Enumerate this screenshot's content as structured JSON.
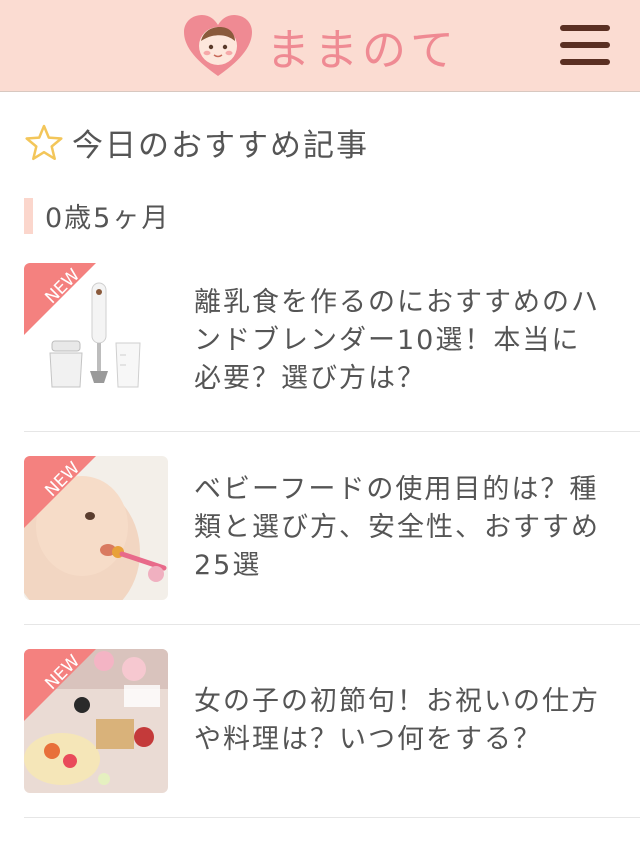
{
  "header": {
    "logo_text": "ままのて",
    "logo_icon": "baby-heart-icon",
    "menu_icon": "hamburger-menu-icon"
  },
  "section": {
    "title": "今日のおすすめ記事",
    "star_icon": "star-outline-icon",
    "age_label": "0歳5ヶ月"
  },
  "articles": [
    {
      "badge": "NEW",
      "title": "離乳食を作るのにおすすめのハンドブレンダー10選！本当に必要？選び方は？",
      "image": "hand-blender"
    },
    {
      "badge": "NEW",
      "title": "ベビーフードの使用目的は？種類と選び方、安全性、おすすめ25選",
      "image": "baby-eating"
    },
    {
      "badge": "NEW",
      "title": "女の子の初節句！お祝いの仕方や料理は？いつ何をする？",
      "image": "hinamatsuri-food"
    }
  ],
  "colors": {
    "header_bg": "#fbdcd2",
    "logo_pink": "#ef8a93",
    "menu_brown": "#5a2f22",
    "ribbon": "#f4817f",
    "star": "#f3c65a"
  }
}
